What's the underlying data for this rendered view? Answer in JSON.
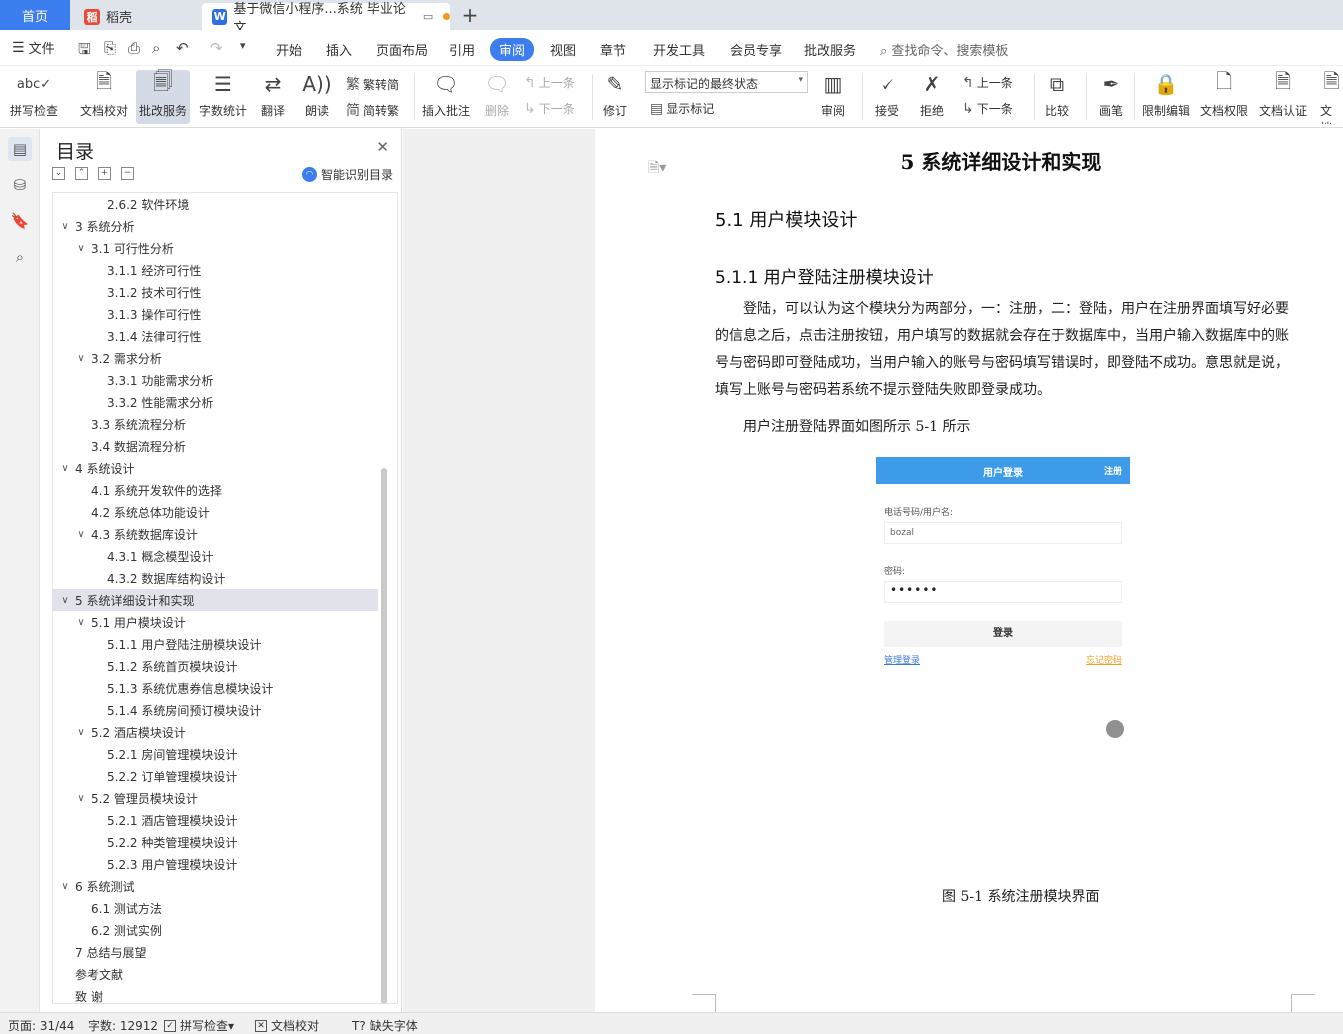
{
  "tabs": {
    "home": "首页",
    "straw": "稻壳",
    "document": "基于微信小程序...系统 毕业论文"
  },
  "menu": {
    "file": "文件",
    "items": [
      "开始",
      "插入",
      "页面布局",
      "引用",
      "审阅",
      "视图",
      "章节",
      "开发工具",
      "会员专享",
      "批改服务"
    ],
    "active": "审阅",
    "search": "查找命令、搜索模板"
  },
  "ribbon": {
    "spellcheck": "拼写检查",
    "proofread": "文档校对",
    "correction": "批改服务",
    "wordcount": "字数统计",
    "translate": "翻译",
    "read_aloud": "朗读",
    "to_traditional": "繁转简",
    "to_simplified": "简转繁",
    "insert_comment": "插入批注",
    "delete": "删除",
    "prev": "上一条",
    "next": "下一条",
    "revise": "修订",
    "mark_state": "显示标记的最终状态",
    "show_marks": "显示标记",
    "review": "审阅",
    "accept": "接受",
    "reject": "拒绝",
    "prev2": "上一条",
    "next2": "下一条",
    "compare": "比较",
    "pen": "画笔",
    "restrict_edit": "限制编辑",
    "doc_permission": "文档权限",
    "doc_cert": "文档认证",
    "doc_more": "文档"
  },
  "toc": {
    "title": "目录",
    "smart": "智能识别目录",
    "items": [
      {
        "label": "2.6.2 软件环境",
        "level": 3,
        "arrow": ""
      },
      {
        "label": "3 系统分析",
        "level": 1,
        "arrow": "v"
      },
      {
        "label": "3.1 可行性分析",
        "level": 2,
        "arrow": "v"
      },
      {
        "label": "3.1.1 经济可行性",
        "level": 3,
        "arrow": ""
      },
      {
        "label": "3.1.2 技术可行性",
        "level": 3,
        "arrow": ""
      },
      {
        "label": "3.1.3 操作可行性",
        "level": 3,
        "arrow": ""
      },
      {
        "label": "3.1.4 法律可行性",
        "level": 3,
        "arrow": ""
      },
      {
        "label": "3.2 需求分析",
        "level": 2,
        "arrow": "v"
      },
      {
        "label": "3.3.1 功能需求分析",
        "level": 3,
        "arrow": ""
      },
      {
        "label": "3.3.2 性能需求分析",
        "level": 3,
        "arrow": ""
      },
      {
        "label": "3.3 系统流程分析",
        "level": 2,
        "arrow": ""
      },
      {
        "label": "3.4 数据流程分析",
        "level": 2,
        "arrow": ""
      },
      {
        "label": "4 系统设计",
        "level": 1,
        "arrow": "v"
      },
      {
        "label": "4.1 系统开发软件的选择",
        "level": 2,
        "arrow": ""
      },
      {
        "label": "4.2 系统总体功能设计",
        "level": 2,
        "arrow": ""
      },
      {
        "label": "4.3 系统数据库设计",
        "level": 2,
        "arrow": "v"
      },
      {
        "label": "4.3.1 概念模型设计",
        "level": 3,
        "arrow": ""
      },
      {
        "label": "4.3.2 数据库结构设计",
        "level": 3,
        "arrow": ""
      },
      {
        "label": "5 系统详细设计和实现",
        "level": 1,
        "arrow": "v",
        "selected": true
      },
      {
        "label": "5.1 用户模块设计",
        "level": 2,
        "arrow": "v"
      },
      {
        "label": "5.1.1 用户登陆注册模块设计",
        "level": 3,
        "arrow": ""
      },
      {
        "label": "5.1.2 系统首页模块设计",
        "level": 3,
        "arrow": ""
      },
      {
        "label": "5.1.3 系统优惠券信息模块设计",
        "level": 3,
        "arrow": ""
      },
      {
        "label": "5.1.4 系统房间预订模块设计",
        "level": 3,
        "arrow": ""
      },
      {
        "label": "5.2 酒店模块设计",
        "level": 2,
        "arrow": "v"
      },
      {
        "label": "5.2.1 房间管理模块设计",
        "level": 3,
        "arrow": ""
      },
      {
        "label": "5.2.2 订单管理模块设计",
        "level": 3,
        "arrow": ""
      },
      {
        "label": "5.2 管理员模块设计",
        "level": 2,
        "arrow": "v"
      },
      {
        "label": "5.2.1 酒店管理模块设计",
        "level": 3,
        "arrow": ""
      },
      {
        "label": "5.2.2 种类管理模块设计",
        "level": 3,
        "arrow": ""
      },
      {
        "label": "5.2.3 用户管理模块设计",
        "level": 3,
        "arrow": ""
      },
      {
        "label": "6 系统测试",
        "level": 1,
        "arrow": "v"
      },
      {
        "label": "6.1 测试方法",
        "level": 2,
        "arrow": ""
      },
      {
        "label": "6.2 测试实例",
        "level": 2,
        "arrow": ""
      },
      {
        "label": "7 总结与展望",
        "level": 1,
        "arrow": ""
      },
      {
        "label": "参考文献",
        "level": 1,
        "arrow": ""
      },
      {
        "label": "致 谢",
        "level": 1,
        "arrow": ""
      }
    ]
  },
  "doc": {
    "h1": "5 系统详细设计和实现",
    "h2": "5.1 用户模块设计",
    "h3": "5.1.1 用户登陆注册模块设计",
    "para": "登陆，可以认为这个模块分为两部分，一：注册，二：登陆，用户在注册界面填写好必要的信息之后，点击注册按钮，用户填写的数据就会存在于数据库中，当用户输入数据库中的账号与密码即可登陆成功，当用户输入的账号与密码填写错误时，即登陆不成功。意思就是说，填写上账号与密码若系统不提示登陆失败即登录成功。",
    "para2": "用户注册登陆界面如图所示 5-1 所示",
    "figure": {
      "title": "用户登录",
      "register": "注册",
      "user_label": "电话号码/用户名:",
      "user_value": "bozal",
      "pwd_label": "密码:",
      "pwd_value": "••••••",
      "login_btn": "登录",
      "admin_link": "管理登录",
      "forgot_link": "忘记密码"
    },
    "caption": "图 5-1 系统注册模块界面"
  },
  "status": {
    "page": "页面: 31/44",
    "words": "字数: 12912",
    "spell": "拼写检查",
    "proof": "文档校对",
    "missing_font": "缺失字体"
  },
  "colors": {
    "accent": "#3c7ef0",
    "figure_header": "#3d9be9"
  }
}
